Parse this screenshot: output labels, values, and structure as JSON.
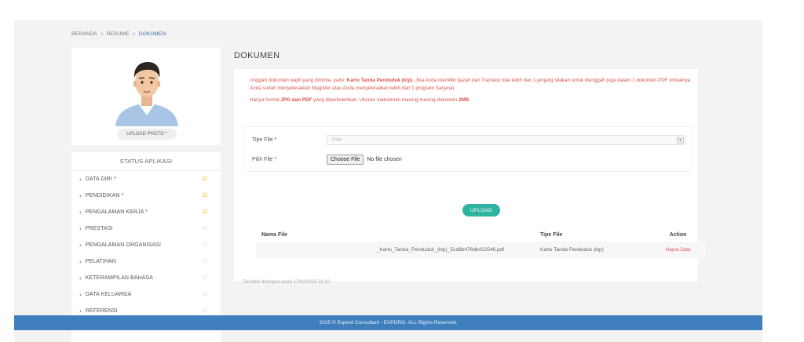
{
  "breadcrumb": {
    "items": [
      "BERANDA",
      "RESUME",
      "DOKUMEN"
    ],
    "separator": ">"
  },
  "profile": {
    "upload_photo_label": "UPLOAD PHOTO *"
  },
  "status": {
    "title": "STATUS APLIKASI",
    "items": [
      {
        "label": "DATA DIRI *",
        "done": true
      },
      {
        "label": "PENDIDIKAN *",
        "done": true
      },
      {
        "label": "PENGALAMAN KERJA *",
        "done": true
      },
      {
        "label": "PRESTASI",
        "done": false
      },
      {
        "label": "PENGALAMAN ORGANISASI",
        "done": false
      },
      {
        "label": "PELATIHAN",
        "done": false
      },
      {
        "label": "KETERAMPILAN BAHASA",
        "done": false
      },
      {
        "label": "DATA KELUARGA",
        "done": false
      },
      {
        "label": "REFERENSI",
        "done": false
      }
    ]
  },
  "main": {
    "title": "DOKUMEN",
    "notice": {
      "line1_a": "Unggah dokumen wajib yang diminta, yaitu: ",
      "line1_b": "Kartu Tanda Penduduk (ktp)",
      "line1_c": ". Jika Anda memiliki Ijazah dan Transkip nilai lebih dari 1 jenjang silakan untuk diunggah juga dalam 1 dokumen PDF (misalnya Anda sudah menyelesaikan Magister atau Anda menyelesaikan lebih dari 1 program Sarjana)",
      "line2_a": "Hanya format ",
      "line2_b": "JPG dan PDF",
      "line2_c": " yang diperbolehkan. Ukuran maksimum masing-masing dokumen ",
      "line2_d": "2MB",
      "line2_e": "."
    },
    "form": {
      "tipe_file_label": "Tipe File *",
      "tipe_file_value": "Pilih",
      "pilih_file_label": "Pilih File *",
      "choose_file_label": "Choose File",
      "no_file_text": "No file chosen"
    },
    "upload_label": "UPLOAD",
    "table": {
      "headers": [
        "Nama File",
        "Tipe File",
        "Action"
      ],
      "rows": [
        {
          "nama_file": "_Kartu_Tanda_Penduduk_(ktp)_51d8b476db422546.pdf",
          "tipe_file": "Kartu Tanda Penduduk (ktp)",
          "action": "Hapus Data"
        }
      ]
    },
    "last_saved": "Terakhir disimpan pada 17/02/2025 11:32"
  },
  "footer": {
    "text": "2025 © Experd Consultant - EXPDRO. ALL Rights Reserved."
  },
  "colors": {
    "accent": "#2db3a0",
    "footer": "#3f7fbe",
    "notice": "#d9534f",
    "done_check": "#e6b800"
  },
  "icons": {
    "chevron": "chevron-right-icon",
    "check": "checkbox-check-icon",
    "select_arrow": "chevron-down-icon"
  }
}
